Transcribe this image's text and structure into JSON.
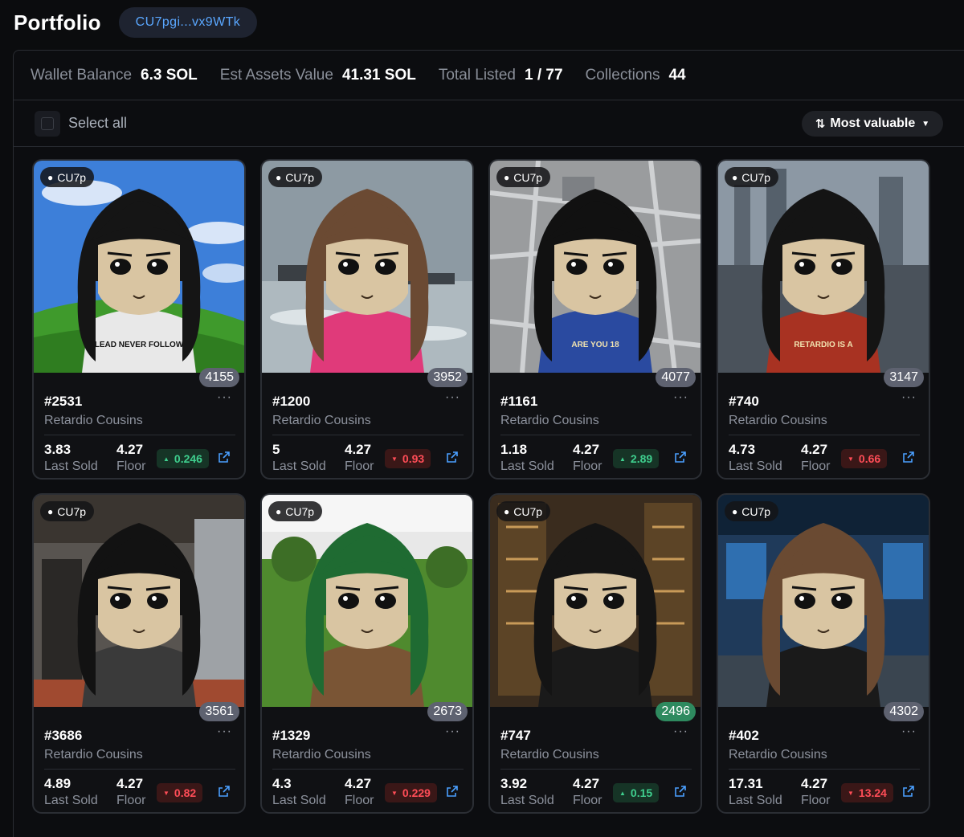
{
  "header": {
    "title": "Portfolio",
    "wallet": "CU7pgi...vx9WTk"
  },
  "stats": [
    {
      "label": "Wallet Balance",
      "value": "6.3 SOL"
    },
    {
      "label": "Est Assets Value",
      "value": "41.31 SOL"
    },
    {
      "label": "Total Listed",
      "value": "1 / 77"
    },
    {
      "label": "Collections",
      "value": "44"
    }
  ],
  "toolbar": {
    "select_all": "Select all",
    "sort": "Most valuable"
  },
  "labels": {
    "last_sold": "Last Sold",
    "floor": "Floor"
  },
  "cards": [
    {
      "owner": "CU7p",
      "rank": "4155",
      "rank_color": "#5e6270",
      "id": "#2531",
      "collection": "Retardio Cousins",
      "last_sold": "3.83",
      "floor": "4.27",
      "change": "0.246",
      "dir": "up",
      "bg": "xp",
      "hair": "#151515",
      "shirt": "#e8e8e8",
      "shirt_text": "LEAD NEVER FOLLOW"
    },
    {
      "owner": "CU7p",
      "rank": "3952",
      "rank_color": "#5e6270",
      "id": "#1200",
      "collection": "Retardio Cousins",
      "last_sold": "5",
      "floor": "4.27",
      "change": "0.93",
      "dir": "down",
      "bg": "sea",
      "hair": "#6b4a33",
      "shirt": "#e03a7a",
      "shirt_text": ""
    },
    {
      "owner": "CU7p",
      "rank": "4077",
      "rank_color": "#5e6270",
      "id": "#1161",
      "collection": "Retardio Cousins",
      "last_sold": "1.18",
      "floor": "4.27",
      "change": "2.89",
      "dir": "up",
      "bg": "map",
      "hair": "#111111",
      "shirt": "#2a4aa0",
      "shirt_text": "ARE YOU 18"
    },
    {
      "owner": "CU7p",
      "rank": "3147",
      "rank_color": "#5e6270",
      "id": "#740",
      "collection": "Retardio Cousins",
      "last_sold": "4.73",
      "floor": "4.27",
      "change": "0.66",
      "dir": "down",
      "bg": "office",
      "hair": "#141414",
      "shirt": "#a83222",
      "shirt_text": "RETARDIO IS A CHINESE COIN"
    },
    {
      "owner": "CU7p",
      "rank": "3561",
      "rank_color": "#5e6270",
      "id": "#3686",
      "collection": "Retardio Cousins",
      "last_sold": "4.89",
      "floor": "4.27",
      "change": "0.82",
      "dir": "down",
      "bg": "kitchen",
      "hair": "#121212",
      "shirt": "#3a3a3a",
      "shirt_text": ""
    },
    {
      "owner": "CU7p",
      "rank": "2673",
      "rank_color": "#5e6270",
      "id": "#1329",
      "collection": "Retardio Cousins",
      "last_sold": "4.3",
      "floor": "4.27",
      "change": "0.229",
      "dir": "down",
      "bg": "field",
      "hair": "#1f6b32",
      "shirt": "#7a5535",
      "shirt_text": ""
    },
    {
      "owner": "CU7p",
      "rank": "2496",
      "rank_color": "#2e8a5f",
      "id": "#747",
      "collection": "Retardio Cousins",
      "last_sold": "3.92",
      "floor": "4.27",
      "change": "0.15",
      "dir": "up",
      "bg": "vault",
      "hair": "#141414",
      "shirt": "#1a1a1a",
      "shirt_text": ""
    },
    {
      "owner": "CU7p",
      "rank": "4302",
      "rank_color": "#5e6270",
      "id": "#402",
      "collection": "Retardio Cousins",
      "last_sold": "17.31",
      "floor": "4.27",
      "change": "13.24",
      "dir": "down",
      "bg": "exchange",
      "hair": "#6a4a32",
      "shirt": "#1a1a1a",
      "shirt_text": ""
    }
  ]
}
